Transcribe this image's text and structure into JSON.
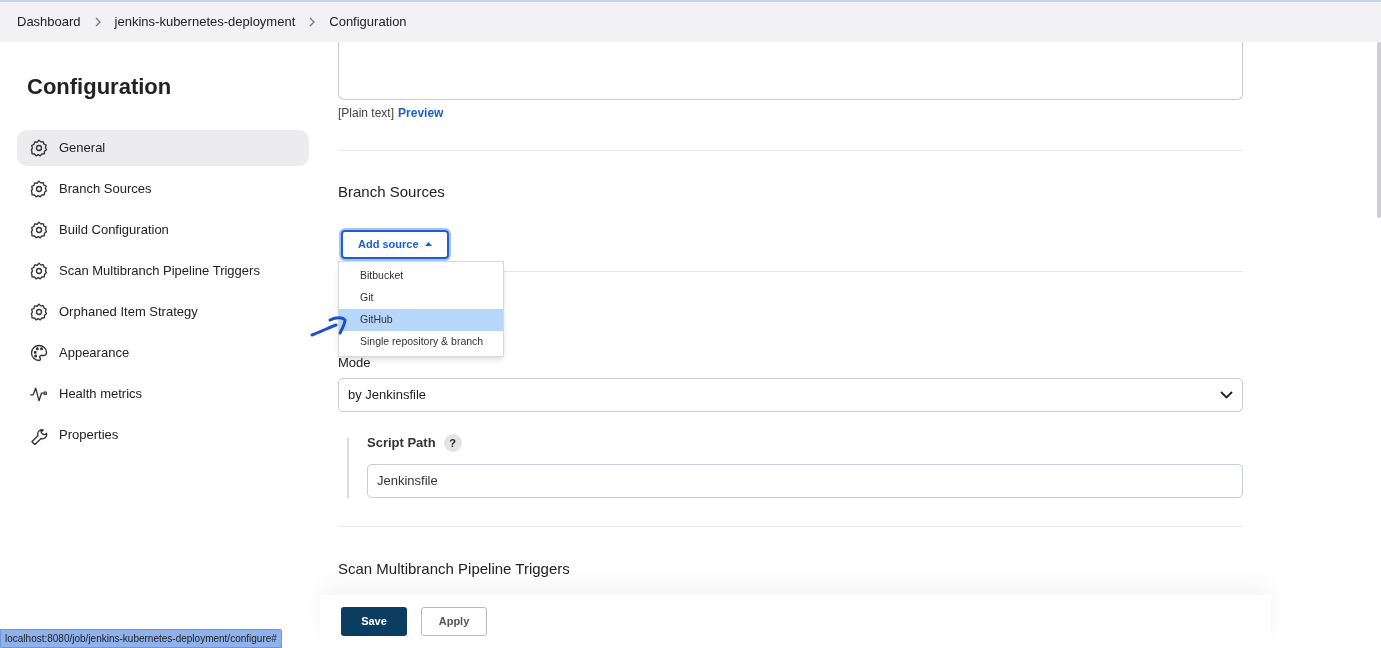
{
  "breadcrumbs": [
    {
      "label": "Dashboard"
    },
    {
      "label": "jenkins-kubernetes-deployment"
    },
    {
      "label": "Configuration"
    }
  ],
  "sidebar": {
    "title": "Configuration",
    "items": [
      {
        "label": "General",
        "kind": "gear",
        "selected": true
      },
      {
        "label": "Branch Sources",
        "kind": "gear",
        "selected": false
      },
      {
        "label": "Build Configuration",
        "kind": "gear",
        "selected": false
      },
      {
        "label": "Scan Multibranch Pipeline Triggers",
        "kind": "gear",
        "selected": false
      },
      {
        "label": "Orphaned Item Strategy",
        "kind": "gear",
        "selected": false
      },
      {
        "label": "Appearance",
        "kind": "palette",
        "selected": false
      },
      {
        "label": "Health metrics",
        "kind": "pulse",
        "selected": false
      },
      {
        "label": "Properties",
        "kind": "wrench",
        "selected": false
      }
    ]
  },
  "description": {
    "format": "[Plain text]",
    "preview_link": "Preview"
  },
  "branch_sources": {
    "heading": "Branch Sources",
    "add_button": "Add source",
    "menu": [
      {
        "label": "Bitbucket",
        "selected": false
      },
      {
        "label": "Git",
        "selected": false
      },
      {
        "label": "GitHub",
        "selected": true
      },
      {
        "label": "Single repository & branch",
        "selected": false
      }
    ]
  },
  "build_configuration": {
    "mode_label": "Mode",
    "mode_value": "by Jenkinsfile",
    "script_path_label": "Script Path",
    "help": "?",
    "script_path_value": "Jenkinsfile"
  },
  "next_section": {
    "heading": "Scan Multibranch Pipeline Triggers"
  },
  "buttons": {
    "save": "Save",
    "apply": "Apply"
  },
  "status_url": "localhost:8080/job/jenkins-kubernetes-deployment/configure#"
}
